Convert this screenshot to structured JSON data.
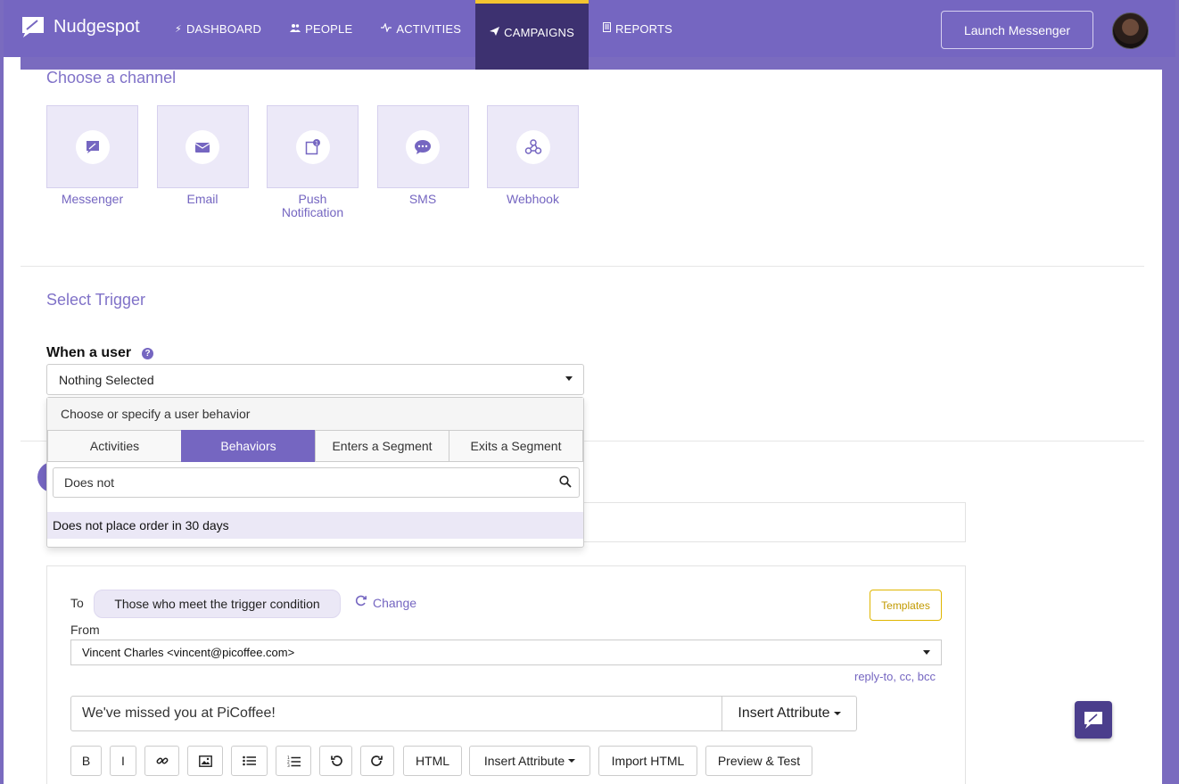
{
  "app": {
    "name": "Nudgespot"
  },
  "nav": {
    "items": [
      {
        "label": "DASHBOARD",
        "icon": "bolt-icon",
        "glyph": "⚡"
      },
      {
        "label": "PEOPLE",
        "icon": "people-icon",
        "glyph": "👥"
      },
      {
        "label": "ACTIVITIES",
        "icon": "pulse-icon",
        "glyph": "⌇"
      },
      {
        "label": "CAMPAIGNS",
        "icon": "paper-plane-icon",
        "glyph": "➤",
        "active": true
      },
      {
        "label": "REPORTS",
        "icon": "document-icon",
        "glyph": "▤"
      }
    ],
    "launch_label": "Launch Messenger"
  },
  "channel_section": {
    "title": "Choose a channel",
    "channels": [
      {
        "label": "Messenger",
        "icon": "chat-bubble-icon"
      },
      {
        "label": "Email",
        "icon": "envelope-icon"
      },
      {
        "label": "Push Notification",
        "icon": "notification-badge-icon"
      },
      {
        "label": "SMS",
        "icon": "sms-bubble-icon"
      },
      {
        "label": "Webhook",
        "icon": "webhook-icon"
      }
    ]
  },
  "trigger": {
    "title": "Select Trigger",
    "when_label": "When a user",
    "select_value": "Nothing Selected",
    "dropdown": {
      "header": "Choose or specify a user behavior",
      "tabs": [
        "Activities",
        "Behaviors",
        "Enters a Segment",
        "Exits a Segment"
      ],
      "active_tab": "Behaviors",
      "search_value": "Does not",
      "results": [
        "Does not place order in 30 days"
      ]
    }
  },
  "email": {
    "to_label": "To",
    "to_value": "Those who meet the trigger condition",
    "change_label": "Change",
    "templates_label": "Templates",
    "from_label": "From",
    "from_value": "Vincent Charles <vincent@picoffee.com>",
    "reply_link": "reply-to, cc, bcc",
    "subject": "We've missed you at PiCoffee!",
    "insert_attribute_label": "Insert Attribute",
    "toolbar": {
      "bold": "B",
      "italic": "I",
      "html": "HTML",
      "insert_attribute": "Insert Attribute",
      "import_html": "Import HTML",
      "preview_test": "Preview & Test"
    }
  },
  "colors": {
    "brand": "#7566c1",
    "nav_active": "#3d3170",
    "active_accent": "#f4c430",
    "templates": "#e0b600"
  }
}
